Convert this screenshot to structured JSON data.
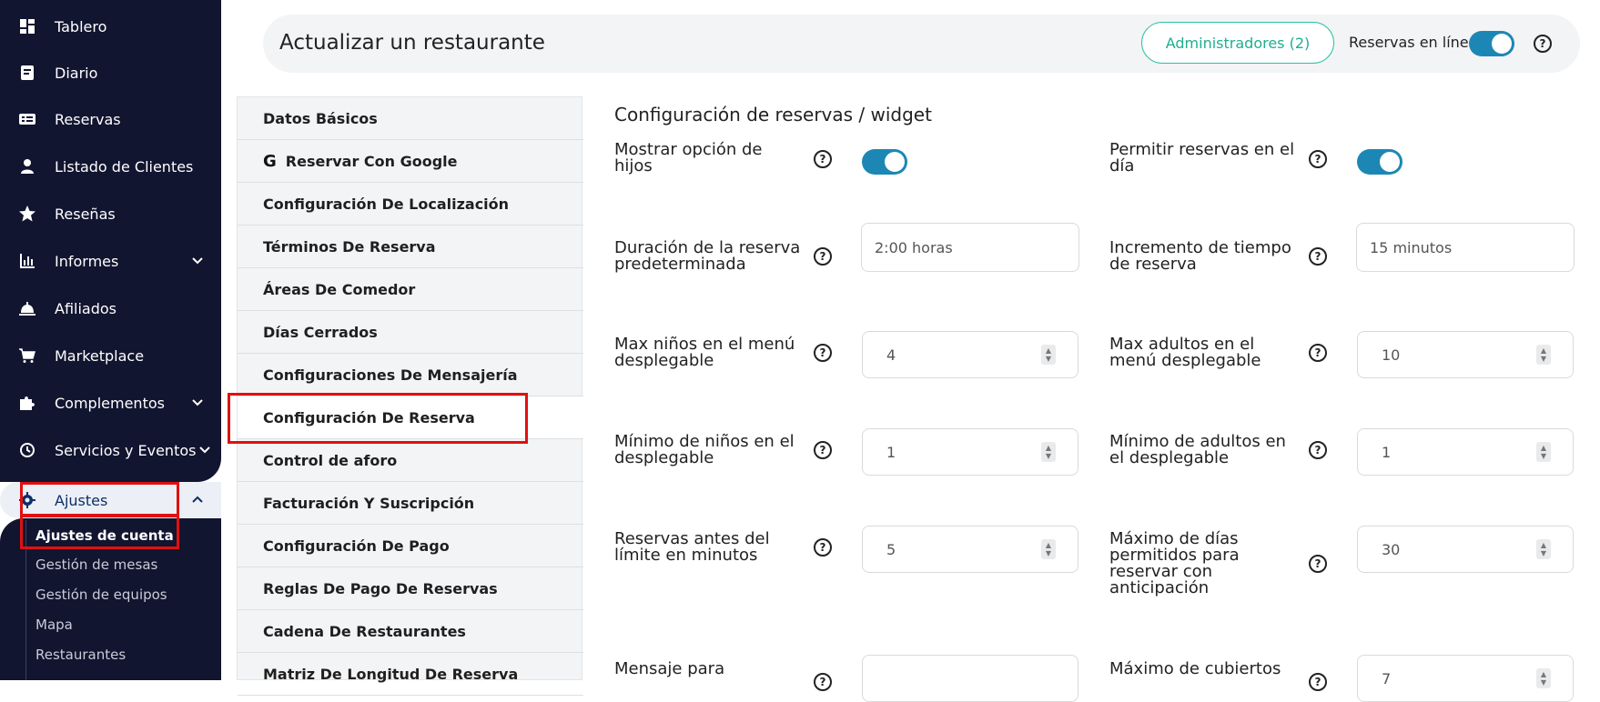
{
  "sidebar": {
    "items": [
      {
        "label": "Tablero",
        "icon": "dashboard-icon"
      },
      {
        "label": "Diario",
        "icon": "book-icon"
      },
      {
        "label": "Reservas",
        "icon": "reservations-icon"
      },
      {
        "label": "Listado de Clientes",
        "icon": "user-icon"
      },
      {
        "label": "Reseñas",
        "icon": "star-icon"
      },
      {
        "label": "Informes",
        "icon": "chart-icon"
      },
      {
        "label": "Afiliados",
        "icon": "bell-icon"
      },
      {
        "label": "Marketplace",
        "icon": "cart-icon"
      },
      {
        "label": "Complementos",
        "icon": "puzzle-icon"
      },
      {
        "label": "Servicios y Eventos",
        "icon": "clock-icon"
      }
    ],
    "active": {
      "label": "Ajustes",
      "icon": "gear-icon"
    },
    "subitems": [
      "Ajustes de cuenta",
      "Gestión de mesas",
      "Gestión de equipos",
      "Mapa",
      "Restaurantes"
    ]
  },
  "header": {
    "title": "Actualizar un restaurante",
    "admins_button": "Administradores (2)",
    "online_label": "Reservas en línea",
    "online_enabled": true
  },
  "tabs": [
    "Datos Básicos",
    "Reservar Con Google",
    "Configuración De Localización",
    "Términos De Reserva",
    "Áreas De Comedor",
    "Días Cerrados",
    "Configuraciones De Mensajería",
    "Configuración De Reserva",
    "Control de aforo",
    "Facturación Y Suscripción",
    "Configuración De Pago",
    "Reglas De Pago De Reservas",
    "Cadena De Restaurantes",
    "Matriz De Longitud De Reserva"
  ],
  "active_tab_index": 7,
  "section": {
    "title": "Configuración de reservas / widget",
    "fields": {
      "show_children": {
        "label_l1": "Mostrar opción de",
        "label_l2": "hijos",
        "enabled": true
      },
      "same_day": {
        "label_l1": "Permitir reservas en el",
        "label_l2": "día",
        "enabled": true
      },
      "default_duration": {
        "label_l1": "Duración de la reserva",
        "label_l2": "predeterminada",
        "value": "2:00 horas"
      },
      "time_increment": {
        "label_l1": "Incremento de tiempo",
        "label_l2": "de reserva",
        "value": "15 minutos"
      },
      "max_children": {
        "label_l1": "Max niños en el menú",
        "label_l2": "desplegable",
        "value": "4"
      },
      "max_adults": {
        "label_l1": "Max adultos en el",
        "label_l2": "menú desplegable",
        "value": "10"
      },
      "min_children": {
        "label_l1": "Mínimo de niños en el",
        "label_l2": "desplegable",
        "value": "1"
      },
      "min_adults": {
        "label_l1": "Mínimo de adultos en",
        "label_l2": "el desplegable",
        "value": "1"
      },
      "before_limit": {
        "label_l1": "Reservas antes del",
        "label_l2": "límite en minutos",
        "value": "5"
      },
      "max_days": {
        "label_l1": "Máximo de días",
        "label_l2": "permitidos para",
        "label_l3": "reservar con",
        "label_l4": "anticipación",
        "value": "30"
      },
      "message": {
        "label_l1": "Mensaje para",
        "value": ""
      },
      "max_covers": {
        "label_l1": "Máximo de cubiertos",
        "value": "7"
      }
    }
  }
}
